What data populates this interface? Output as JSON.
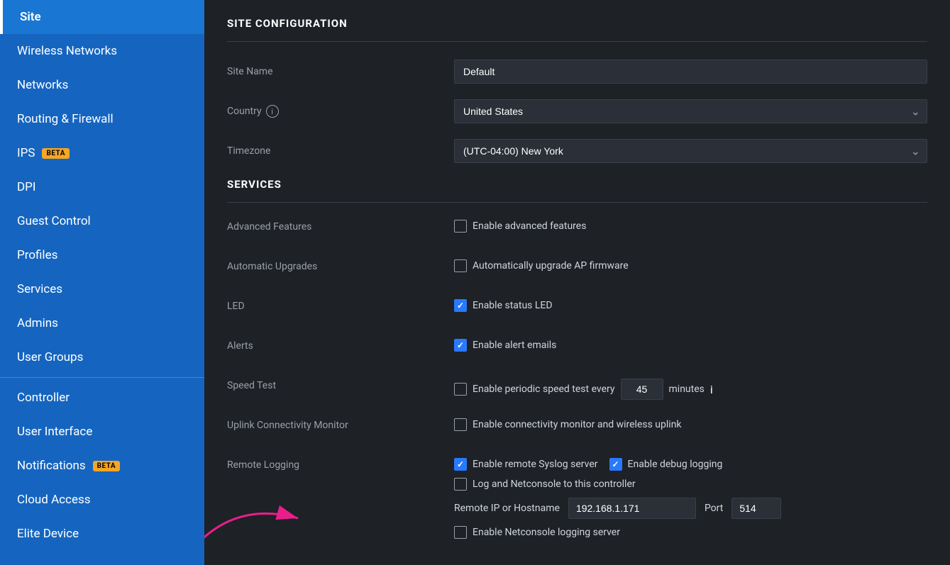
{
  "sidebar": {
    "items": [
      {
        "id": "site",
        "label": "Site",
        "active": true,
        "badge": null
      },
      {
        "id": "wireless-networks",
        "label": "Wireless Networks",
        "active": false,
        "badge": null
      },
      {
        "id": "networks",
        "label": "Networks",
        "active": false,
        "badge": null
      },
      {
        "id": "routing-firewall",
        "label": "Routing & Firewall",
        "active": false,
        "badge": null
      },
      {
        "id": "ips",
        "label": "IPS",
        "active": false,
        "badge": "BETA"
      },
      {
        "id": "dpi",
        "label": "DPI",
        "active": false,
        "badge": null
      },
      {
        "id": "guest-control",
        "label": "Guest Control",
        "active": false,
        "badge": null
      },
      {
        "id": "profiles",
        "label": "Profiles",
        "active": false,
        "badge": null
      },
      {
        "id": "services",
        "label": "Services",
        "active": false,
        "badge": null
      },
      {
        "id": "admins",
        "label": "Admins",
        "active": false,
        "badge": null
      },
      {
        "id": "user-groups",
        "label": "User Groups",
        "active": false,
        "badge": null
      },
      {
        "id": "divider1",
        "label": null,
        "active": false,
        "badge": null,
        "divider": true
      },
      {
        "id": "controller",
        "label": "Controller",
        "active": false,
        "badge": null
      },
      {
        "id": "user-interface",
        "label": "User Interface",
        "active": false,
        "badge": null
      },
      {
        "id": "notifications",
        "label": "Notifications",
        "active": false,
        "badge": "BETA"
      },
      {
        "id": "cloud-access",
        "label": "Cloud Access",
        "active": false,
        "badge": null
      },
      {
        "id": "elite-device",
        "label": "Elite Device",
        "active": false,
        "badge": null
      }
    ]
  },
  "main": {
    "page_title": "SITE CONFIGURATION",
    "site_name_label": "Site Name",
    "site_name_value": "Default",
    "country_label": "Country",
    "country_value": "United States",
    "timezone_label": "Timezone",
    "timezone_value": "(UTC-04:00) New York",
    "services_title": "SERVICES",
    "services": [
      {
        "id": "advanced-features",
        "label": "Advanced Features",
        "controls": [
          {
            "type": "checkbox",
            "checked": false,
            "text": "Enable advanced features"
          }
        ]
      },
      {
        "id": "automatic-upgrades",
        "label": "Automatic Upgrades",
        "controls": [
          {
            "type": "checkbox",
            "checked": false,
            "text": "Automatically upgrade AP firmware"
          }
        ]
      },
      {
        "id": "led",
        "label": "LED",
        "controls": [
          {
            "type": "checkbox",
            "checked": true,
            "text": "Enable status LED"
          }
        ]
      },
      {
        "id": "alerts",
        "label": "Alerts",
        "controls": [
          {
            "type": "checkbox",
            "checked": true,
            "text": "Enable alert emails"
          }
        ]
      },
      {
        "id": "speed-test",
        "label": "Speed Test",
        "controls": [
          {
            "type": "speed-test",
            "checked": false,
            "text": "Enable periodic speed test every",
            "value": "45",
            "unit": "minutes"
          }
        ]
      },
      {
        "id": "uplink-connectivity-monitor",
        "label": "Uplink Connectivity Monitor",
        "controls": [
          {
            "type": "checkbox",
            "checked": false,
            "text": "Enable connectivity monitor and wireless uplink"
          }
        ]
      },
      {
        "id": "remote-logging",
        "label": "Remote Logging",
        "controls": [
          {
            "type": "remote-logging",
            "syslog_checked": true,
            "syslog_text": "Enable remote Syslog server",
            "debug_checked": true,
            "debug_text": "Enable debug logging",
            "netconsole_checked": false,
            "netconsole_text": "Log and Netconsole to this controller",
            "remote_ip_label": "Remote IP or Hostname",
            "remote_ip_value": "192.168.1.171",
            "port_label": "Port",
            "port_value": "514",
            "enable_netconsole_checked": false,
            "enable_netconsole_text": "Enable Netconsole logging server"
          }
        ]
      }
    ],
    "info_icon_title": "i"
  }
}
